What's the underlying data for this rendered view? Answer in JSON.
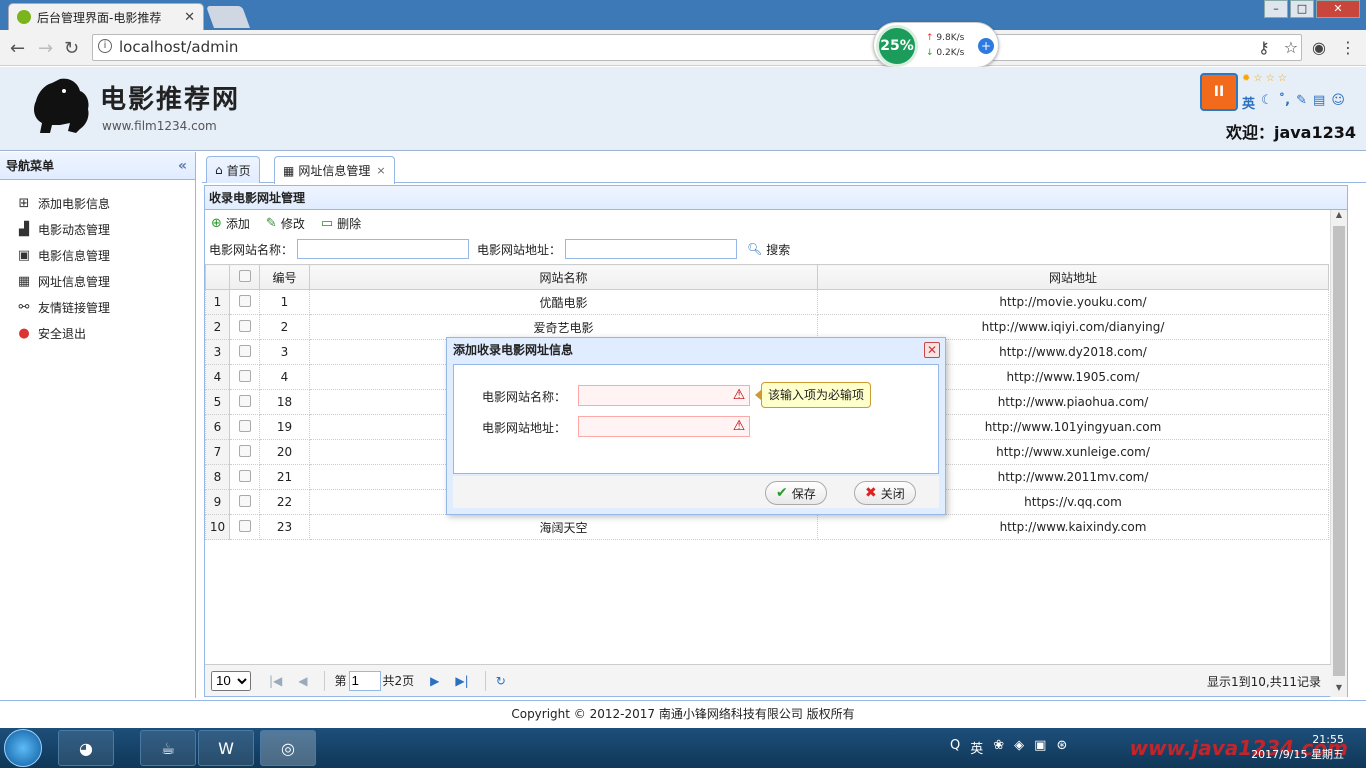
{
  "browser": {
    "tab_title": "后台管理界面-电影推荐",
    "tab_close": "✕",
    "url": "localhost/admin",
    "net_percent": "25%",
    "net_up": "9.8K/s",
    "net_down": "0.2K/s"
  },
  "header": {
    "logo_title": "电影推荐网",
    "logo_sub": "www.film1234.com",
    "welcome": "欢迎：java1234",
    "tool_lang": "英"
  },
  "sidebar": {
    "title": "导航菜单",
    "items": [
      {
        "label": "添加电影信息",
        "icon": "add-icon"
      },
      {
        "label": "电影动态管理",
        "icon": "chart-icon"
      },
      {
        "label": "电影信息管理",
        "icon": "film-icon"
      },
      {
        "label": "网址信息管理",
        "icon": "monitor-icon"
      },
      {
        "label": "友情链接管理",
        "icon": "link-icon"
      },
      {
        "label": "安全退出",
        "icon": "exit-icon"
      }
    ]
  },
  "tabs": [
    {
      "label": "首页"
    },
    {
      "label": "网址信息管理",
      "close": "×"
    }
  ],
  "panel": {
    "title": "收录电影网址管理",
    "toolbar": {
      "add": "添加",
      "edit": "修改",
      "delete": "删除"
    },
    "search": {
      "name_label": "电影网站名称：",
      "url_label": "电影网站地址：",
      "button": "搜索"
    }
  },
  "grid": {
    "headers": [
      "编号",
      "网站名称",
      "网站地址"
    ],
    "rows": [
      {
        "rn": "1",
        "id": "1",
        "name": "优酷电影",
        "url": "http://movie.youku.com/"
      },
      {
        "rn": "2",
        "id": "2",
        "name": "爱奇艺电影",
        "url": "http://www.iqiyi.com/dianying/"
      },
      {
        "rn": "3",
        "id": "3",
        "name": "",
        "url": "http://www.dy2018.com/"
      },
      {
        "rn": "4",
        "id": "4",
        "name": "",
        "url": "http://www.1905.com/"
      },
      {
        "rn": "5",
        "id": "18",
        "name": "",
        "url": "http://www.piaohua.com/"
      },
      {
        "rn": "6",
        "id": "19",
        "name": "",
        "url": "http://www.101yingyuan.com"
      },
      {
        "rn": "7",
        "id": "20",
        "name": "",
        "url": "http://www.xunleige.com/"
      },
      {
        "rn": "8",
        "id": "21",
        "name": "",
        "url": "http://www.2011mv.com/"
      },
      {
        "rn": "9",
        "id": "22",
        "name": "",
        "url": "https://v.qq.com"
      },
      {
        "rn": "10",
        "id": "23",
        "name": "海阔天空",
        "url": "http://www.kaixindy.com"
      }
    ]
  },
  "pager": {
    "page_size": "10",
    "page_prefix": "第",
    "page_value": "1",
    "page_suffix": "共2页",
    "info": "显示1到10,共11记录"
  },
  "footer": {
    "copyright": "Copyright © 2012-2017 南通小锋网络科技有限公司 版权所有"
  },
  "dialog": {
    "title": "添加收录电影网址信息",
    "name_label": "电影网站名称：",
    "url_label": "电影网站地址：",
    "tooltip": "该输入项为必输项",
    "save": "保存",
    "close": "关闭"
  },
  "taskbar": {
    "tray_lang": "英",
    "time": "21:55",
    "date": "2017/9/15 星期五",
    "watermark": "www.java1234.com"
  }
}
